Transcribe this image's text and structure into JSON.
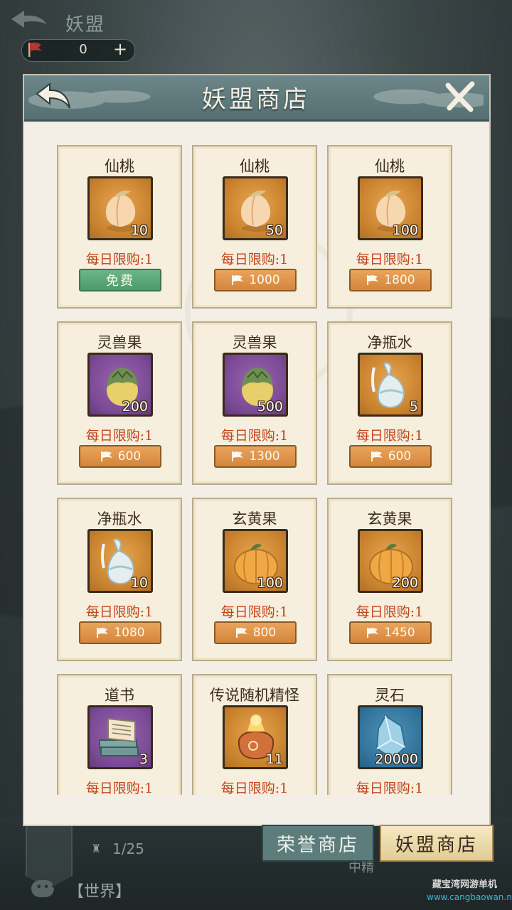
{
  "top_bar": {
    "title": "妖盟",
    "currency_value": "0",
    "plus": "+"
  },
  "panel": {
    "title": "妖盟商店"
  },
  "items": [
    {
      "name": "仙桃",
      "qty": "10",
      "limit": "每日限购:1",
      "price": "免费",
      "free": true,
      "bg": "orange",
      "icon": "peach-icon"
    },
    {
      "name": "仙桃",
      "qty": "50",
      "limit": "每日限购:1",
      "price": "1000",
      "free": false,
      "bg": "orange",
      "icon": "peach-icon"
    },
    {
      "name": "仙桃",
      "qty": "100",
      "limit": "每日限购:1",
      "price": "1800",
      "free": false,
      "bg": "orange",
      "icon": "peach-icon"
    },
    {
      "name": "灵兽果",
      "qty": "200",
      "limit": "每日限购:1",
      "price": "600",
      "free": false,
      "bg": "purple",
      "icon": "spirit-fruit-icon"
    },
    {
      "name": "灵兽果",
      "qty": "500",
      "limit": "每日限购:1",
      "price": "1300",
      "free": false,
      "bg": "purple",
      "icon": "spirit-fruit-icon"
    },
    {
      "name": "净瓶水",
      "qty": "5",
      "limit": "每日限购:1",
      "price": "600",
      "free": false,
      "bg": "orange",
      "icon": "vase-water-icon"
    },
    {
      "name": "净瓶水",
      "qty": "10",
      "limit": "每日限购:1",
      "price": "1080",
      "free": false,
      "bg": "orange",
      "icon": "vase-water-icon"
    },
    {
      "name": "玄黄果",
      "qty": "100",
      "limit": "每日限购:1",
      "price": "800",
      "free": false,
      "bg": "orange",
      "icon": "pumpkin-fruit-icon"
    },
    {
      "name": "玄黄果",
      "qty": "200",
      "limit": "每日限购:1",
      "price": "1450",
      "free": false,
      "bg": "orange",
      "icon": "pumpkin-fruit-icon"
    },
    {
      "name": "道书",
      "qty": "3",
      "limit": "每日限购:1",
      "price": "",
      "free": false,
      "bg": "purple",
      "icon": "book-stack-icon"
    },
    {
      "name": "传说随机精怪",
      "qty": "11",
      "limit": "每日限购:1",
      "price": "",
      "free": false,
      "bg": "orange",
      "icon": "treasure-bag-icon"
    },
    {
      "name": "灵石",
      "qty": "20000",
      "limit": "每日限购:1",
      "price": "",
      "free": false,
      "bg": "blue",
      "icon": "spirit-stone-icon"
    }
  ],
  "tabs": {
    "honor": "荣誉商店",
    "yaomeng": "妖盟商店"
  },
  "bottom": {
    "progress": "1/25",
    "chat_label": "【世界】",
    "bar_text": "中精"
  },
  "watermark": {
    "name": "藏宝湾网游单机",
    "url": "www.cangbaowan.net"
  },
  "colors": {
    "limit_text": "#c4421c",
    "price_button": "#d4853c",
    "free_button": "#4d9a6c",
    "header": "#5f797b"
  }
}
